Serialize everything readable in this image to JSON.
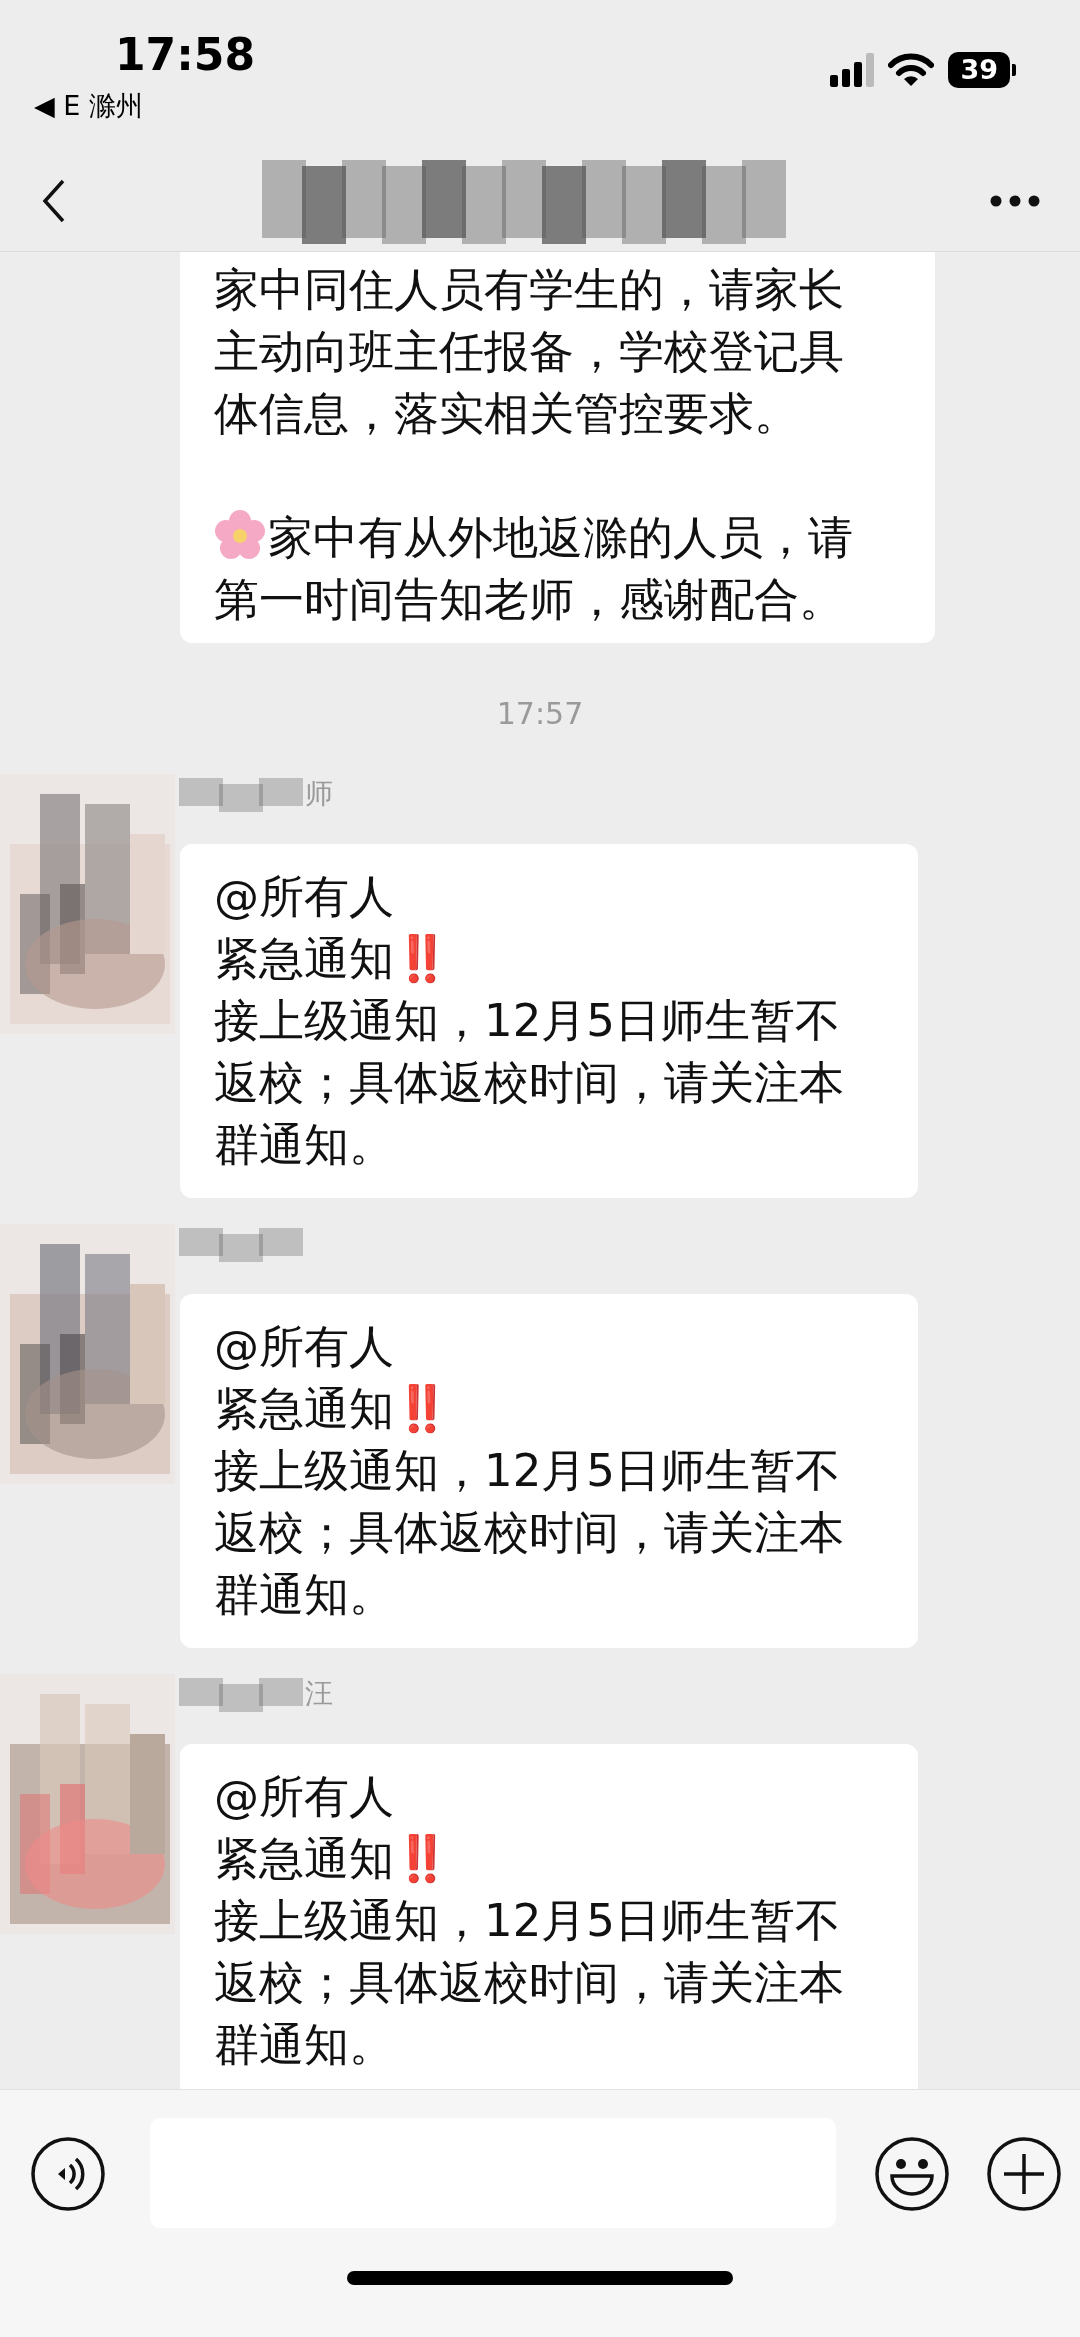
{
  "status_bar": {
    "time": "17:58",
    "back_app": "◀ E 滁州",
    "battery": "39"
  },
  "chat": {
    "messages": [
      {
        "kind": "partial",
        "paragraphs": [
          {
            "lines": [
              "家中同住人员有学生的，请家长",
              "主动向班主任报备，学校登记具",
              "体信息，落实相关管控要求。"
            ]
          },
          {
            "flower": true,
            "lines": [
              "家中有从外地返滁的人员，请",
              "第一时间告知老师，感谢配合。"
            ]
          }
        ]
      },
      {
        "kind": "time",
        "text": "17:57"
      },
      {
        "kind": "received",
        "sender": "师",
        "paragraphs": [
          {
            "lines": [
              "@所有人"
            ]
          },
          {
            "lines": [
              "紧急通知"
            ],
            "alert": "‼️"
          },
          {
            "lines": [
              "接上级通知，12月5日师生暂不",
              "返校；具体返校时间，请关注本",
              "群通知。"
            ]
          }
        ]
      },
      {
        "kind": "received",
        "paragraphs": [
          {
            "lines": [
              "@所有人"
            ]
          },
          {
            "lines": [
              "紧急通知"
            ],
            "alert": "‼️"
          },
          {
            "lines": [
              "接上级通知，12月5日师生暂不",
              "返校；具体返校时间，请关注本",
              "群通知。"
            ]
          }
        ]
      },
      {
        "kind": "received",
        "sender": "汪",
        "paragraphs": [
          {
            "lines": [
              "@所有人"
            ]
          },
          {
            "lines": [
              "紧急通知"
            ],
            "alert": "‼️"
          },
          {
            "lines": [
              "接上级通知，12月5日师生暂不",
              "返校；具体返校时间，请关注本",
              "群通知。"
            ]
          }
        ]
      }
    ]
  }
}
